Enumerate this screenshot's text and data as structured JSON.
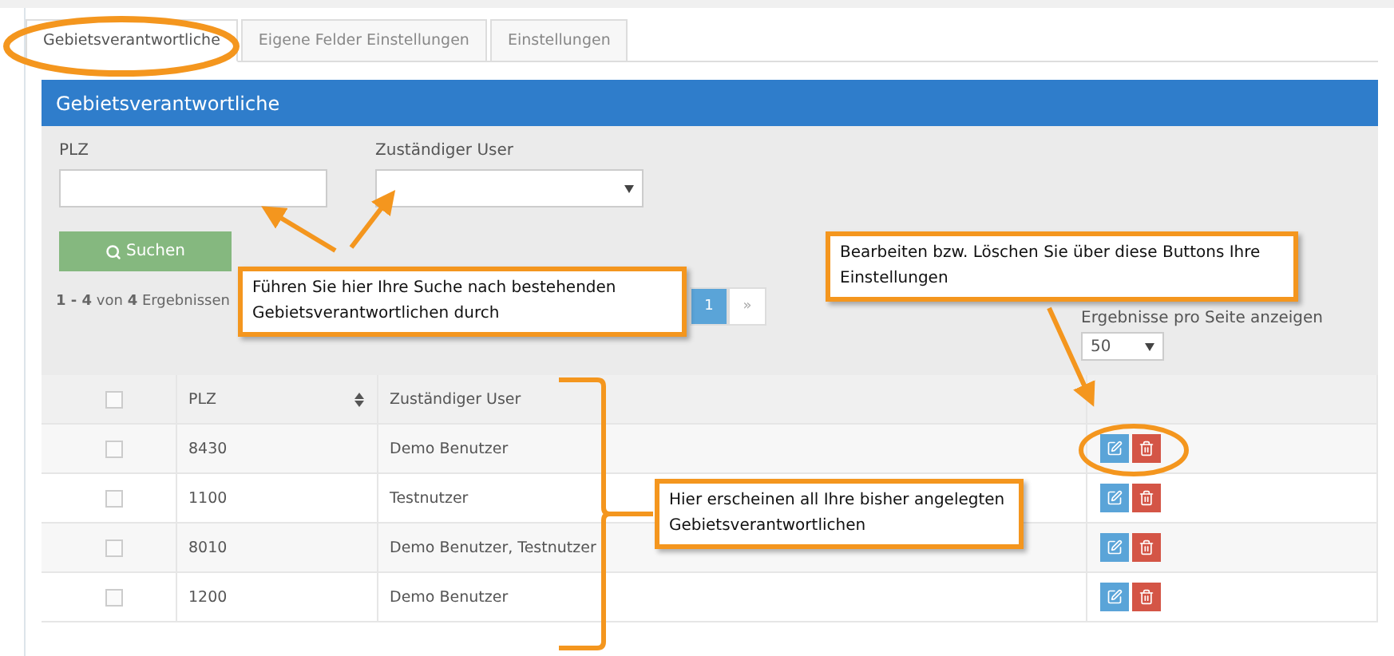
{
  "tabs": [
    {
      "label": "Gebietsverantwortliche",
      "selected": true
    },
    {
      "label": "Eigene Felder Einstellungen",
      "selected": false
    },
    {
      "label": "Einstellungen",
      "selected": false
    }
  ],
  "panel": {
    "title": "Gebietsverantwortliche",
    "filters": [
      {
        "kind": "text",
        "label": "PLZ"
      },
      {
        "kind": "select",
        "label": "Zuständiger User"
      }
    ],
    "search_button": "Suchen",
    "results": {
      "from": "1",
      "sep": " - ",
      "to": "4",
      "of": " von ",
      "total": "4",
      "suffix": " Ergebnissen"
    },
    "pagination": [
      {
        "label": "1",
        "selected": true
      },
      {
        "label": "»",
        "selected": false
      }
    ],
    "per_page": {
      "label": "Ergebnisse pro Seite anzeigen",
      "value": "50"
    },
    "table": {
      "columns": [
        "PLZ",
        "Zuständiger User"
      ],
      "all_checked": false,
      "rows": [
        {
          "plz": "8430",
          "user": "Demo Benutzer",
          "checked": false
        },
        {
          "plz": "1100",
          "user": "Testnutzer",
          "checked": false
        },
        {
          "plz": "8010",
          "user": "Demo Benutzer, Testnutzer",
          "checked": false
        },
        {
          "plz": "1200",
          "user": "Demo Benutzer",
          "checked": false
        }
      ]
    }
  },
  "annotations": [
    {
      "text": "Führen Sie hier Ihre Suche nach bestehenden Gebietsverantwortlichen durch"
    },
    {
      "text": "Bearbeiten bzw. Löschen Sie über diese Buttons Ihre Einstellungen"
    },
    {
      "text": "Hier erscheinen all Ihre bisher angelegten Gebietsverantwortlichen"
    }
  ]
}
